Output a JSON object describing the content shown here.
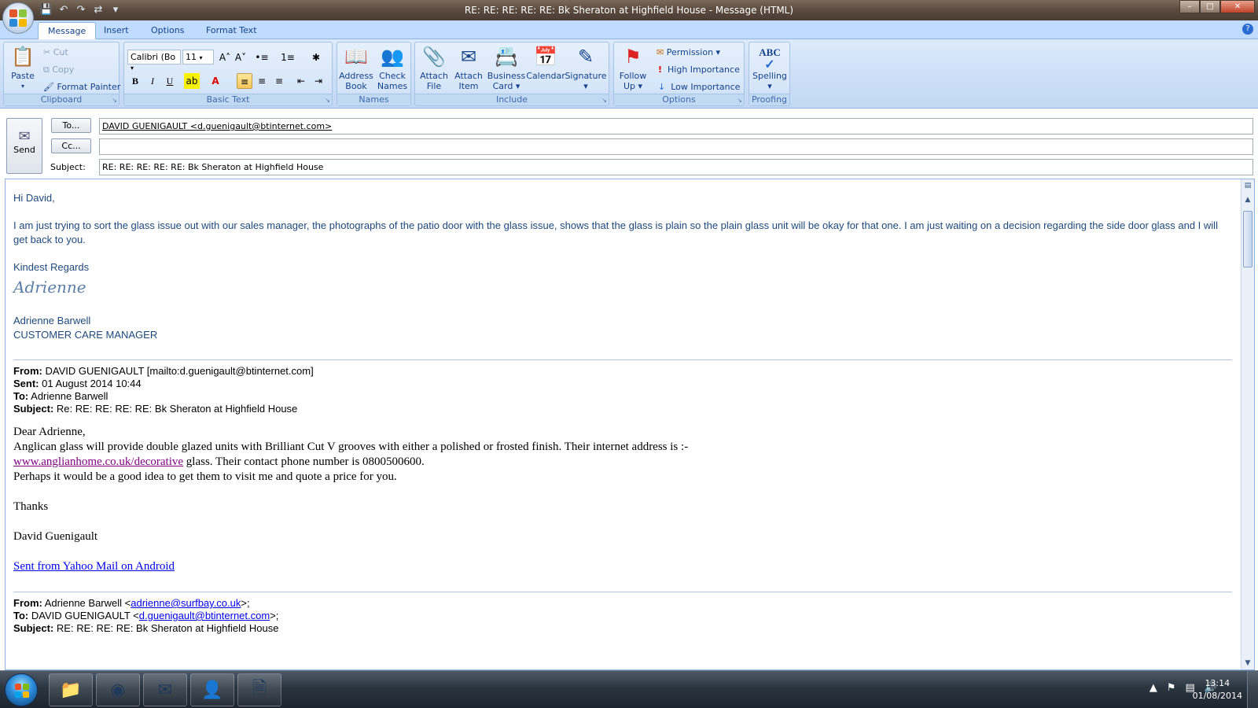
{
  "window": {
    "title": "RE: RE: RE: RE: RE: Bk Sheraton at Highfield House  - Message (HTML)",
    "controls": {
      "minimize": "–",
      "maximize": "□",
      "close": "✕"
    }
  },
  "qat_icons": [
    "save-icon",
    "undo-icon",
    "redo-icon",
    "arrows-icon",
    "customize-icon"
  ],
  "tabs": [
    {
      "label": "Message",
      "active": true
    },
    {
      "label": "Insert",
      "active": false
    },
    {
      "label": "Options",
      "active": false
    },
    {
      "label": "Format Text",
      "active": false
    }
  ],
  "help_label": "?",
  "ribbon": {
    "clipboard": {
      "name": "Clipboard",
      "paste": "Paste",
      "cut": "Cut",
      "copy": "Copy",
      "format_painter": "Format Painter"
    },
    "basic_text": {
      "name": "Basic Text",
      "font": "Calibri (Bo",
      "size": "11",
      "grow": "A˄",
      "shrink": "A˅",
      "bold": "B",
      "italic": "I",
      "underline": "U",
      "font_color": "A"
    },
    "names": {
      "name": "Names",
      "address_book": [
        "Address",
        "Book"
      ],
      "check_names": [
        "Check",
        "Names"
      ]
    },
    "include": {
      "name": "Include",
      "attach_file": [
        "Attach",
        "File"
      ],
      "attach_item": [
        "Attach",
        "Item"
      ],
      "business_card": [
        "Business",
        "Card ▾"
      ],
      "calendar": "Calendar",
      "signature": [
        "Signature",
        "▾"
      ]
    },
    "options": {
      "name": "Options",
      "follow_up": [
        "Follow",
        "Up ▾"
      ],
      "permission": "Permission ▾",
      "high_importance": "High Importance",
      "low_importance": "Low Importance"
    },
    "proofing": {
      "name": "Proofing",
      "spelling": [
        "Spelling",
        "▾"
      ],
      "abc": "ABC"
    }
  },
  "compose": {
    "send": "Send",
    "to_button": "To...",
    "cc_button": "Cc...",
    "subject_label": "Subject:",
    "to_value": "DAVID GUENIGAULT <d.guenigault@btinternet.com>",
    "cc_value": "",
    "subject_value": "RE: RE: RE: RE: RE: Bk Sheraton at Highfield House"
  },
  "message": {
    "greeting": "Hi David,",
    "body": "I am just trying to sort the glass issue out with our sales manager,   the photographs of the patio door with the glass issue, shows that the glass is plain so the plain glass unit will be okay for that one.  I am just waiting on a decision regarding the side door glass and I will get back to you.",
    "closing": "Kindest Regards",
    "signature_script": "Adrienne",
    "sender_name": "Adrienne Barwell",
    "sender_title": "CUSTOMER CARE MANAGER",
    "quoted1": {
      "from_label": "From:",
      "from": "DAVID GUENIGAULT [mailto:d.guenigault@btinternet.com]",
      "sent_label": "Sent:",
      "sent": "01 August 2014 10:44",
      "to_label": "To:",
      "to": "Adrienne Barwell",
      "subject_label": "Subject:",
      "subject": "Re: RE: RE: RE: RE: Bk Sheraton at Highfield House",
      "salutation": "Dear Adrienne,",
      "line1": "Anglican glass will provide double glazed units with Brilliant Cut V grooves with either a polished or frosted finish. Their internet address is :-",
      "link": "www.anglianhome.co.uk/decorative",
      "line2_rest": " glass. Their contact phone number is 0800500600.",
      "line3": "Perhaps it would be a good idea to get them to visit me and quote a price for you.",
      "thanks": "Thanks",
      "name": "David Guenigault",
      "mobile_link": "Sent from Yahoo Mail on Android"
    },
    "quoted2": {
      "from_label": "From:",
      "from_pre": "Adrienne Barwell <",
      "from_link": "adrienne@surfbay.co.uk",
      "from_post": ">;",
      "to_label": "To:",
      "to_pre": "DAVID GUENIGAULT <",
      "to_link": "d.guenigault@btinternet.com",
      "to_post": ">;",
      "subject_label": "Subject:",
      "subject": "RE: RE: RE: RE: Bk Sheraton at Highfield House"
    }
  },
  "taskbar": {
    "apps": [
      "explorer-icon",
      "chrome-icon",
      "outlook-icon",
      "contacts-icon",
      "word-icon"
    ],
    "time": "13:14",
    "date": "01/08/2014"
  },
  "colors": {
    "accent": "#15428b",
    "ribbon": "#c8dcf6",
    "body_text": "#1f497d",
    "link": "#0000ee",
    "visited_link": "#800080"
  }
}
